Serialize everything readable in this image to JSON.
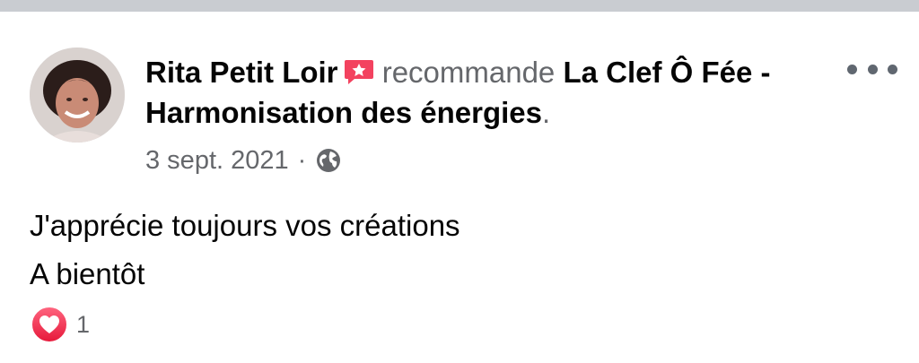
{
  "post": {
    "author": "Rita Petit Loir",
    "author_icon": "recommendation-star-icon",
    "verb": "recommande",
    "page_name": "La Clef Ô Fée - Harmonisation des énergies",
    "period": ".",
    "date": "3 sept. 2021",
    "separator": "·",
    "privacy_icon": "globe-icon",
    "body_lines": [
      "J'apprécie toujours vos créations",
      "A bientôt"
    ],
    "reaction_icon": "love-reaction-icon",
    "reaction_count": "1"
  },
  "colors": {
    "divider": "#c9ccd1",
    "text_primary": "#050505",
    "text_secondary": "#65676b",
    "recommend_icon": "#f3425f",
    "love": "#f33e58"
  }
}
